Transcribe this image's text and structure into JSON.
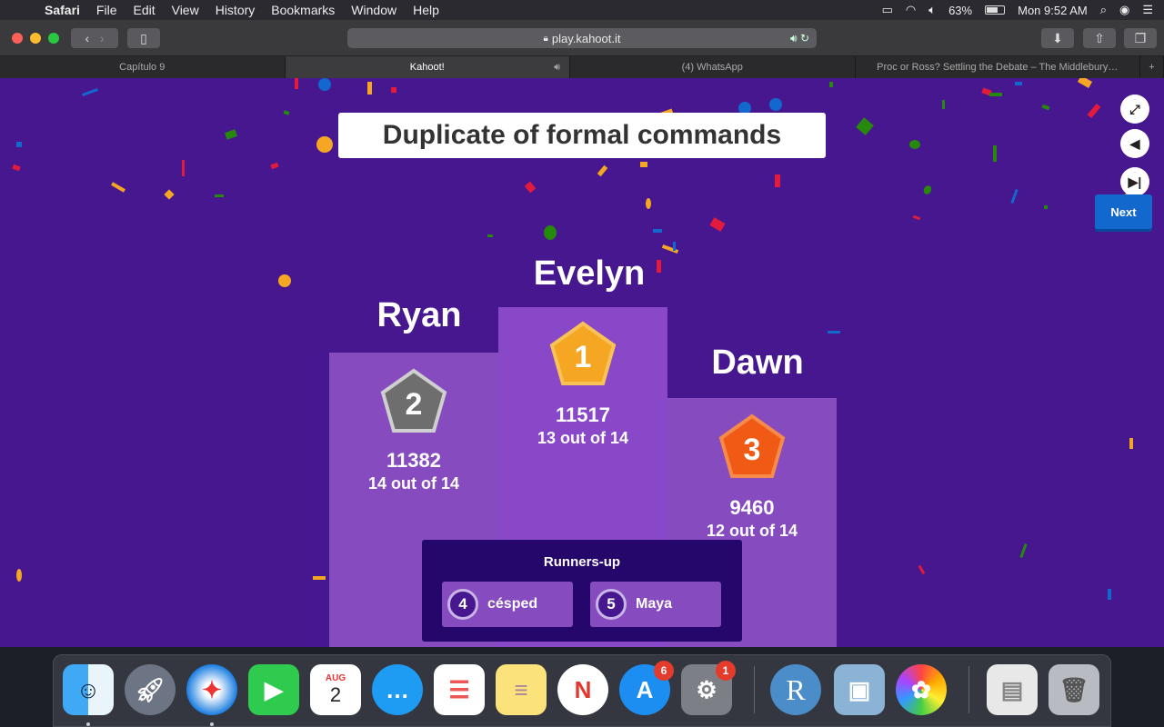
{
  "menubar": {
    "app": "Safari",
    "items": [
      "File",
      "Edit",
      "View",
      "History",
      "Bookmarks",
      "Window",
      "Help"
    ],
    "battery": "63%",
    "clock": "Mon 9:52 AM"
  },
  "browser": {
    "url": "play.kahoot.it",
    "tabs": [
      {
        "title": "Capítulo 9",
        "active": false
      },
      {
        "title": "Kahoot!",
        "active": true,
        "audio": true
      },
      {
        "title": "(4) WhatsApp",
        "active": false
      },
      {
        "title": "Proc or Ross? Settling the Debate – The Middlebury…",
        "active": false
      }
    ]
  },
  "game": {
    "title": "Duplicate of formal commands",
    "next_label": "Next",
    "podium": {
      "first": {
        "name": "Evelyn",
        "rank": "1",
        "score": "11517",
        "correct": "13 out of 14"
      },
      "second": {
        "name": "Ryan",
        "rank": "2",
        "score": "11382",
        "correct": "14 out of 14"
      },
      "third": {
        "name": "Dawn",
        "rank": "3",
        "score": "9460",
        "correct": "12 out of 14"
      }
    },
    "runners_up": {
      "title": "Runners-up",
      "items": [
        {
          "rank": "4",
          "name": "césped"
        },
        {
          "rank": "5",
          "name": "Maya"
        }
      ]
    }
  },
  "dock": {
    "calendar_month": "AUG",
    "calendar_day": "2",
    "appstore_badge": "6",
    "settings_badge": "1",
    "r_label": "R"
  },
  "colors": {
    "stage": "#46178f",
    "podium": "#864cbf",
    "gold": "#f5a623",
    "silver": "#6e6e6e",
    "bronze": "#f05a14",
    "next": "#1368ce"
  }
}
